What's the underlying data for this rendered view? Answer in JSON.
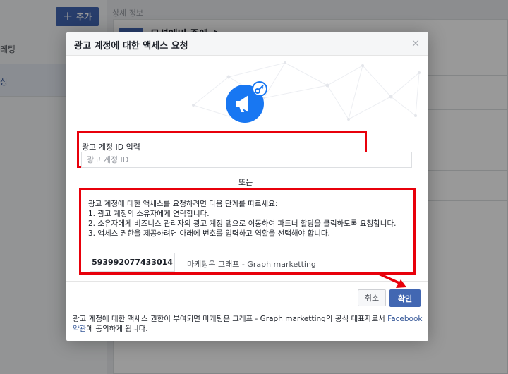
{
  "background": {
    "add_button_label": "추가",
    "nav_item_1": "레팅",
    "nav_item_2": "상",
    "detail_title": "상세 정보",
    "card_title": "모션에비 중에 ♪"
  },
  "dialog": {
    "title": "광고 계정에 대한 액세스 요청",
    "close_glyph": "×",
    "field": {
      "label": "광고 계정 ID 입력",
      "placeholder": "광고 계정 ID",
      "value": ""
    },
    "or_text": "또는",
    "instructions": [
      "광고 계정에 대한 액세스를 요청하려면 다음 단계를 따르세요:",
      "1. 광고 계정의 소유자에게 연락합니다.",
      "2. 소유자에게 비즈니스 관리자의 광고 계정 탭으로 이동하여 파트너 할당을 클릭하도록 요청합니다.",
      "3. 액세스 권한을 제공하려면 아래에 번호를 입력하고 역할을 선택해야 합니다."
    ],
    "partner_code": "593992077433014",
    "partner_name": "마케팅은 그래프 - Graph marketting",
    "cancel_label": "취소",
    "confirm_label": "확인",
    "terms_text": "광고 계정에 대한 액세스 권한이 부여되면 마케팅은 그래프 - Graph marketting의 공식 대표자로서 ",
    "terms_link": "Facebook 약관",
    "terms_suffix": "에 동의하게 됩니다."
  },
  "colors": {
    "brand_blue": "#4267b2",
    "highlight_red": "#e8000b",
    "icon_blue": "#1877f2"
  }
}
